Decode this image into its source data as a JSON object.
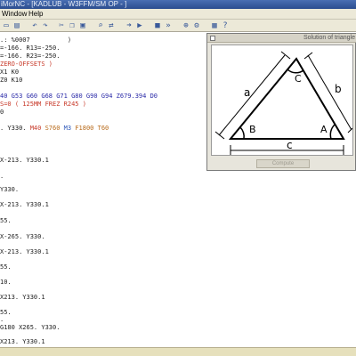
{
  "title": "iMorNC - [KADLUB - W3FFM/SM OP - ]",
  "menu": {
    "window": "Window",
    "help": "Help"
  },
  "toolbar_icons": [
    "save-icon",
    "print-icon",
    "undo-icon",
    "redo-icon",
    "cut-icon",
    "copy-icon",
    "paste-icon",
    "find-icon",
    "replace-icon",
    "goto-icon",
    "run-icon",
    "stop-icon",
    "step-icon",
    "zoom-icon",
    "settings-icon",
    "calc-icon",
    "help-icon"
  ],
  "code": {
    "l1": ".: %0007",
    "l1b": ")",
    "l2": "=-166. R13=-250.",
    "l3": "=-166. R23=-250.",
    "l4": "ZERO-OFFSETS )",
    "l5": "X1 K0",
    "l6": "Z0 K10",
    "l7": "40 G53 G60 G68 G71 G80 G90 G94 Z679.394 D0",
    "l8": "S=0 ( 125MM FREZ R245 )",
    "l9": "0",
    "l10a": ". Y330. ",
    "l10b": "M40 ",
    "l10c": "S760 ",
    "l10d": "M3 ",
    "l10e": "F1800 T60",
    "l11": "X-213. Y330.1",
    "l12": ".",
    "l13": "Y330.",
    "l14": "X-213. Y330.1",
    "l15": "55.",
    "l16": "X-265. Y330.",
    "l17": "X-213. Y330.1",
    "l18": "55.",
    "l19": "10.",
    "l20": "X213. Y330.1",
    "l21": "55.",
    "l22": ".",
    "l23": "G180 X265. Y330.",
    "l24": "X213. Y330.1",
    "l25": "55."
  },
  "dialog": {
    "title": "Solution of triangle",
    "triangle": {
      "a": "a",
      "b": "b",
      "c": "c",
      "A": "A",
      "B": "B",
      "C": "C"
    },
    "button": "Compute"
  }
}
